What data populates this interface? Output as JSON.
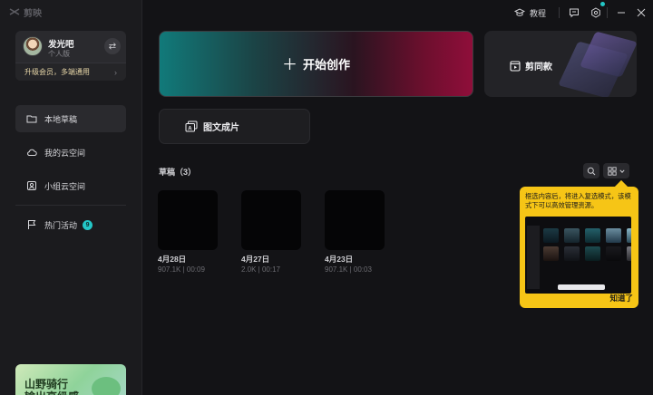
{
  "app": {
    "brand": "剪映"
  },
  "user": {
    "name": "发光吧",
    "tier": "个人版",
    "upgrade": "升级会员，多端通用"
  },
  "sidebar": {
    "items": [
      {
        "label": "本地草稿",
        "active": true
      },
      {
        "label": "我的云空间",
        "active": false
      },
      {
        "label": "小组云空间",
        "active": false
      },
      {
        "label": "热门活动",
        "badge": "9",
        "active": false
      }
    ],
    "promo": "山野骑行\n输出高级感"
  },
  "topbar": {
    "tutorial": "教程"
  },
  "main": {
    "create_label": "开始创作",
    "template_label": "剪同款",
    "imgtext_label": "图文成片",
    "drafts_title": "草稿（3）",
    "drafts": [
      {
        "date": "4月28日",
        "meta": "907.1K | 00:09"
      },
      {
        "date": "4月27日",
        "meta": "2.0K | 00:17"
      },
      {
        "date": "4月23日",
        "meta": "907.1K | 00:03"
      }
    ]
  },
  "tooltip": {
    "text": "框选内容后，将进入复选模式，该模式下可以高效管理资源。",
    "confirm": "知道了"
  },
  "colors": {
    "accent": "#23c6c6",
    "tooltip": "#f6c516"
  }
}
